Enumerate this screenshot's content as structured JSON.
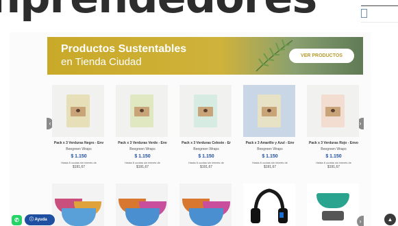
{
  "heading": {
    "text": "nprendedores"
  },
  "banner": {
    "title": "Productos Sustentables",
    "subtitle": "en Tienda Ciudad",
    "button_label": "VER PRODUCTOS"
  },
  "products": [
    {
      "name": "Pack x 3 Verduras Negro - Env",
      "brand": "Beegreen Wraps",
      "price": "$ 1.150",
      "installments": "Hasta 6 cuotas sin interés de",
      "installment_value": "$191,67",
      "color": "#e7dfb8"
    },
    {
      "name": "Pack x 3 Verduras Verde - Env",
      "brand": "Beegreen Wraps",
      "price": "$ 1.150",
      "installments": "Hasta 6 cuotas sin interés de",
      "installment_value": "$191,67",
      "color": "#dfe8c0"
    },
    {
      "name": "Pack x 3 Verduras Celeste - Er",
      "brand": "Beegreen Wraps",
      "price": "$ 1.150",
      "installments": "Hasta 6 cuotas sin interés de",
      "installment_value": "$191,67",
      "color": "#d6ebe2"
    },
    {
      "name": "Pack x 3 Amarillo y Azul - Env",
      "brand": "Beegreen Wraps",
      "price": "$ 1.150",
      "installments": "Hasta 6 cuotas sin interés de",
      "installment_value": "$191,67",
      "color": "#c9d6e6"
    },
    {
      "name": "Pack x 3 Verduras Rojo - Envo",
      "brand": "Beegreen Wraps",
      "price": "$ 1.150",
      "installments": "Hasta 6 cuotas sin interés de",
      "installment_value": "$191,67",
      "color": "#f3ddd0"
    }
  ],
  "widgets": {
    "whatsapp_icon": "whatsapp-icon",
    "help_label": "Ayuda",
    "scroll_top_icon": "chevron-up-icon"
  },
  "colors": {
    "price": "#1f4fa0",
    "banner": "#c9a928",
    "help": "#1f4fa0"
  }
}
